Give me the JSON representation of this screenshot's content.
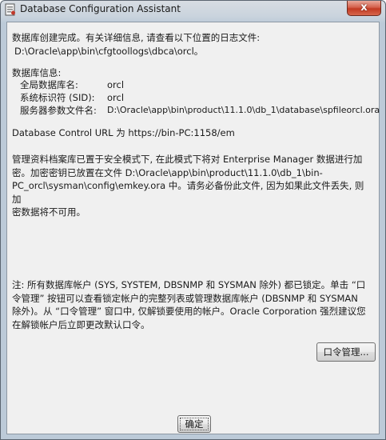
{
  "window": {
    "title": "Database Configuration Assistant",
    "close_glyph": "x"
  },
  "content": {
    "completion_line": "数据库创建完成。有关详细信息, 请查看以下位置的日志文件:",
    "log_path": "D:\\Oracle\\app\\bin\\cfgtoollogs\\dbca\\orcl。",
    "db_info_heading": "数据库信息:",
    "db_info": [
      {
        "label": "全局数据库名:",
        "value": "orcl"
      },
      {
        "label": "系统标识符 (SID):",
        "value": "orcl"
      },
      {
        "label": "服务器参数文件名:",
        "value": "D:\\Oracle\\app\\bin\\product\\11.1.0\\db_1\\database\\spfileorcl.ora"
      }
    ],
    "control_url": "Database Control URL 为 https://bin-PC:1158/em",
    "secure_mode_lines": [
      "管理资料档案库已置于安全模式下, 在此模式下将对 Enterprise Manager 数据进行加",
      "密。加密密钥已放置在文件 D:\\Oracle\\app\\bin\\product\\11.1.0\\db_1\\bin-",
      "PC_orcl\\sysman\\config\\emkey.ora 中。请务必备份此文件, 因为如果此文件丢失, 则加",
      "密数据将不可用。"
    ],
    "note_lines": [
      "注: 所有数据库帐户 (SYS, SYSTEM, DBSNMP 和 SYSMAN 除外) 都已锁定。单击 “口",
      "令管理” 按钮可以查看锁定帐户的完整列表或管理数据库帐户 (DBSNMP 和 SYSMAN",
      "除外)。从 “口令管理” 窗口中, 仅解锁要使用的帐户。Oracle Corporation 强烈建议您",
      "在解锁帐户后立即更改默认口令。"
    ]
  },
  "buttons": {
    "password_mgmt": "口令管理...",
    "ok": "确定"
  }
}
